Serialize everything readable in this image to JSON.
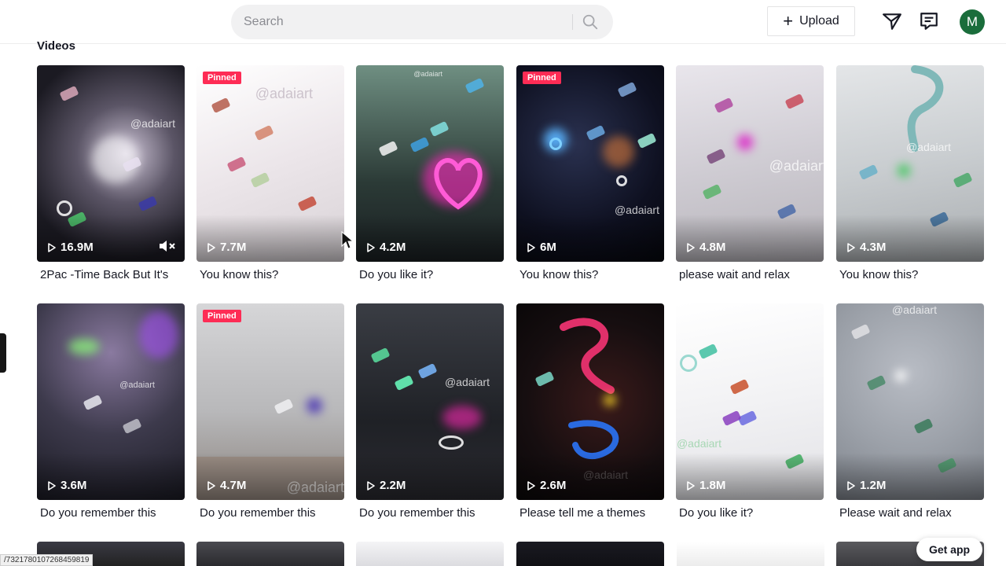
{
  "search": {
    "placeholder": "Search"
  },
  "header": {
    "upload_label": "Upload",
    "avatar_initial": "M"
  },
  "section": {
    "title": "Videos"
  },
  "videos": [
    {
      "views": "16.9M",
      "caption": "2Pac -Time Back But It's",
      "pinned": false,
      "muted": true
    },
    {
      "views": "7.7M",
      "caption": "You know this?",
      "pinned": true
    },
    {
      "views": "4.2M",
      "caption": "Do you like it?",
      "pinned": false
    },
    {
      "views": "6M",
      "caption": "You know this?",
      "pinned": true
    },
    {
      "views": "4.8M",
      "caption": "please wait and relax",
      "pinned": false
    },
    {
      "views": "4.3M",
      "caption": "You know this?",
      "pinned": false
    },
    {
      "views": "3.6M",
      "caption": "Do you remember this",
      "pinned": false
    },
    {
      "views": "4.7M",
      "caption": "Do you remember this",
      "pinned": true
    },
    {
      "views": "2.2M",
      "caption": "Do you remember this",
      "pinned": false
    },
    {
      "views": "2.6M",
      "caption": "Please tell me a themes",
      "pinned": false
    },
    {
      "views": "1.8M",
      "caption": "Do you like it?",
      "pinned": false
    },
    {
      "views": "1.2M",
      "caption": "Please wait and relax",
      "pinned": false
    }
  ],
  "pinned_label": "Pinned",
  "watermark": "@adaiart",
  "status_url": "/7321780107268459819",
  "get_app_label": "Get app",
  "icons": {
    "search": "search-icon",
    "upload": "plus-icon",
    "send": "paper-plane-icon",
    "inbox": "inbox-icon",
    "play": "play-icon",
    "mute": "mute-icon"
  },
  "colors": {
    "accent": "#fe2c55",
    "avatar": "#1a6d3b"
  }
}
